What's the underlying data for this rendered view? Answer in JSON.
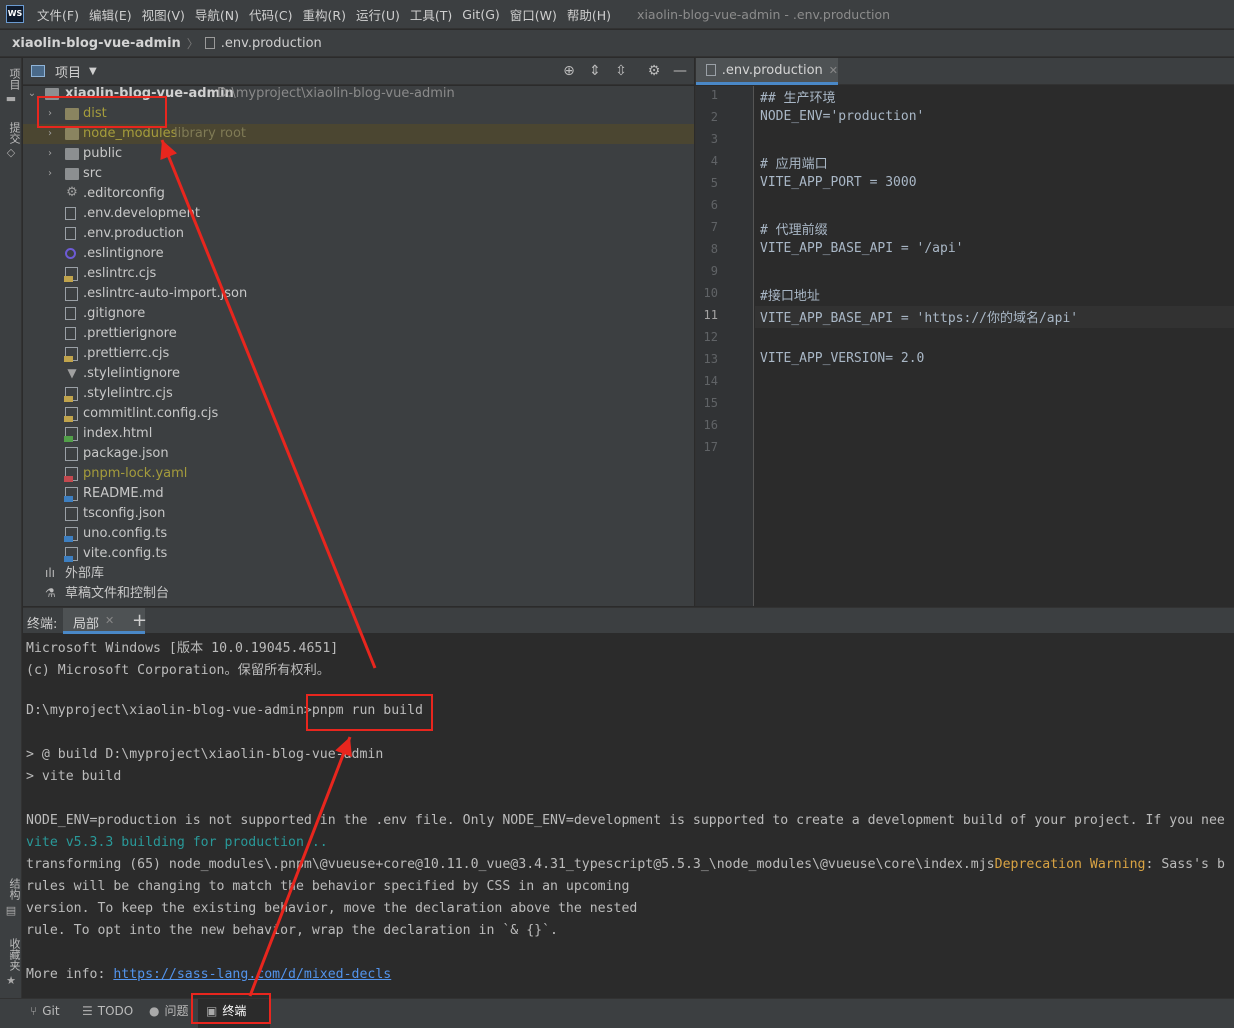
{
  "menubar": {
    "logo": "WS",
    "items": [
      "文件(F)",
      "编辑(E)",
      "视图(V)",
      "导航(N)",
      "代码(C)",
      "重构(R)",
      "运行(U)",
      "工具(T)",
      "Git(G)",
      "窗口(W)",
      "帮助(H)"
    ],
    "window_title": "xiaolin-blog-vue-admin - .env.production"
  },
  "breadcrumb": {
    "project": "xiaolin-blog-vue-admin",
    "separator": "〉",
    "file": ".env.production"
  },
  "left_strip": {
    "project_tab": "项目",
    "commit_tab": "提交",
    "structure_tab": "结构",
    "favorites_tab": "收藏夹"
  },
  "project_panel": {
    "title": "项目",
    "tree": [
      {
        "label": "xiaolin-blog-vue-admin",
        "path": "D:\\myproject\\xiaolin-blog-vue-admin",
        "icon": "folder-icon",
        "level": 0,
        "expanded": true
      },
      {
        "label": "dist",
        "icon": "folder-icon",
        "level": 1,
        "color": "yellow"
      },
      {
        "label": "node_modules",
        "hint": "library root",
        "icon": "folder-icon",
        "level": 1,
        "color": "yellow"
      },
      {
        "label": "public",
        "icon": "folder-icon",
        "level": 1
      },
      {
        "label": "src",
        "icon": "folder-icon",
        "level": 1
      },
      {
        "label": ".editorconfig",
        "icon": "gear-icon",
        "level": 1
      },
      {
        "label": ".env.development",
        "icon": "file-icon",
        "level": 1
      },
      {
        "label": ".env.production",
        "icon": "file-icon",
        "level": 1
      },
      {
        "label": ".eslintignore",
        "icon": "eslint-icon",
        "level": 1
      },
      {
        "label": ".eslintrc.cjs",
        "icon": "js-file-icon",
        "level": 1
      },
      {
        "label": ".eslintrc-auto-import.json",
        "icon": "json-file-icon",
        "level": 1
      },
      {
        "label": ".gitignore",
        "icon": "git-file-icon",
        "level": 1
      },
      {
        "label": ".prettierignore",
        "icon": "file-icon",
        "level": 1
      },
      {
        "label": ".prettierrc.cjs",
        "icon": "js-file-icon",
        "level": 1
      },
      {
        "label": ".stylelintignore",
        "icon": "stylelint-icon",
        "level": 1
      },
      {
        "label": ".stylelintrc.cjs",
        "icon": "js-file-icon",
        "level": 1
      },
      {
        "label": "commitlint.config.cjs",
        "icon": "js-file-icon",
        "level": 1
      },
      {
        "label": "index.html",
        "icon": "html-file-icon",
        "level": 1
      },
      {
        "label": "package.json",
        "icon": "json-file-icon",
        "level": 1
      },
      {
        "label": "pnpm-lock.yaml",
        "icon": "yaml-file-icon",
        "level": 1,
        "color": "yellow"
      },
      {
        "label": "README.md",
        "icon": "md-file-icon",
        "level": 1
      },
      {
        "label": "tsconfig.json",
        "icon": "json-file-icon",
        "level": 1
      },
      {
        "label": "uno.config.ts",
        "icon": "ts-file-icon",
        "level": 1
      },
      {
        "label": "vite.config.ts",
        "icon": "ts-file-icon",
        "level": 1
      },
      {
        "label": "外部库",
        "icon": "library-icon",
        "level": 0
      },
      {
        "label": "草稿文件和控制台",
        "icon": "scratches-icon",
        "level": 0
      }
    ]
  },
  "editor": {
    "tab_label": ".env.production",
    "current_line": 11,
    "lines": [
      "## 生产环境",
      "NODE_ENV='production'",
      "",
      "# 应用端口",
      "VITE_APP_PORT = 3000",
      "",
      "# 代理前缀",
      "VITE_APP_BASE_API = '/api'",
      "",
      "#接口地址",
      "VITE_APP_BASE_API = 'https://你的域名/api'",
      "",
      "VITE_APP_VERSION= 2.0",
      "",
      "",
      "",
      ""
    ]
  },
  "terminal": {
    "title": "终端:",
    "tab_label": "局部",
    "add_label": "+",
    "lines": [
      {
        "text": "Microsoft Windows [版本 10.0.19045.4651]"
      },
      {
        "text": "(c) Microsoft Corporation。保留所有权利。"
      },
      {
        "text": ""
      },
      {
        "text": "D:\\myproject\\xiaolin-blog-vue-admin>pnpm run build"
      },
      {
        "text": ""
      },
      {
        "text": "> @ build D:\\myproject\\xiaolin-blog-vue-admin"
      },
      {
        "text": "> vite build"
      },
      {
        "text": ""
      },
      {
        "text": "NODE_ENV=production is not supported in the .env file. Only NODE_ENV=development is supported to create a development build of your project. If you nee"
      },
      {
        "text": "vite v5.3.3 building for production...",
        "style": "cyan"
      },
      {
        "text": "transforming (65) node_modules\\.pnpm\\@vueuse+core@10.11.0_vue@3.4.31_typescript@5.5.3_\\node_modules\\@vueuse\\core\\index.mjs",
        "suffix_warn": "Deprecation Warning",
        "suffix_rest": ": Sass's b"
      },
      {
        "text": "rules will be changing to match the behavior specified by CSS in an upcoming"
      },
      {
        "text": "version. To keep the existing behavior, move the declaration above the nested"
      },
      {
        "text": "rule. To opt into the new behavior, wrap the declaration in `& {}`."
      },
      {
        "text": ""
      },
      {
        "text": "More info: ",
        "link": "https://sass-lang.com/d/mixed-decls"
      }
    ]
  },
  "bottom_bar": {
    "items": [
      {
        "label": "Git",
        "icon": "git-branch-icon"
      },
      {
        "label": "TODO",
        "icon": "list-icon"
      },
      {
        "label": "问题",
        "icon": "info-icon"
      },
      {
        "label": "终端",
        "icon": "terminal-icon",
        "active": true
      }
    ]
  },
  "annotation_color": "#e8261e"
}
